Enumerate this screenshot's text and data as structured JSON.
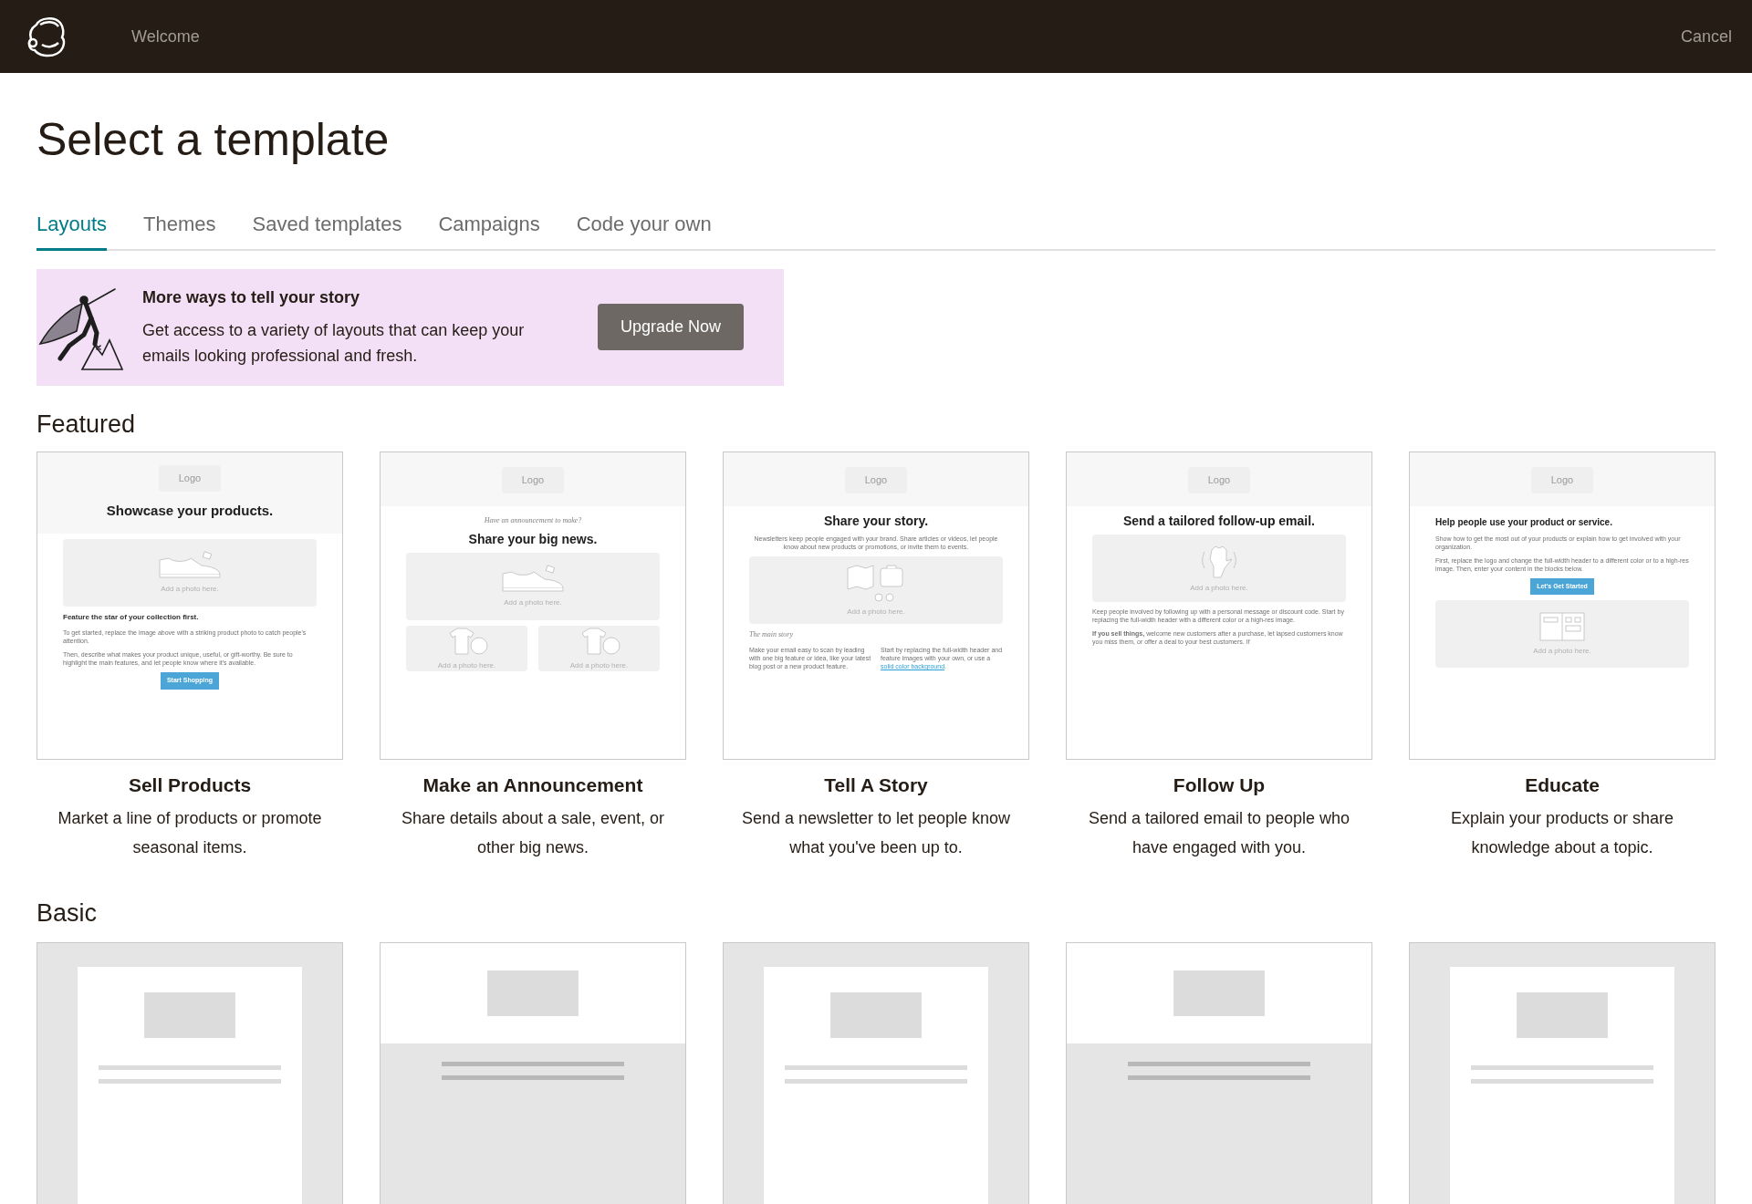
{
  "top_bar": {
    "welcome": "Welcome",
    "cancel": "Cancel"
  },
  "title": "Select a template",
  "tabs": [
    {
      "label": "Layouts",
      "selected": true
    },
    {
      "label": "Themes",
      "selected": false
    },
    {
      "label": "Saved templates",
      "selected": false
    },
    {
      "label": "Campaigns",
      "selected": false
    },
    {
      "label": "Code your own",
      "selected": false
    }
  ],
  "banner": {
    "heading": "More ways to tell your story",
    "text": "Get access to a variety of layouts that can keep your emails looking professional and fresh.",
    "button": "Upgrade Now"
  },
  "featured": {
    "heading": "Featured",
    "templates": [
      {
        "name": "Sell Products",
        "description": "Market a line of products or promote seasonal items.",
        "blocks": [
          {
            "kind": "header",
            "logo": "Logo",
            "heading": "Showcase your products."
          },
          {
            "kind": "photo",
            "caption": "Add a photo here."
          },
          {
            "kind": "subheading",
            "text": "Feature the star of your collection first."
          },
          {
            "kind": "text",
            "text": "To get started, replace the image above with a striking product photo to catch people's attention."
          },
          {
            "kind": "text",
            "text": "Then, describe what makes your product unique, useful, or gift-worthy. Be sure to highlight the main features, and let people know where it's available."
          },
          {
            "kind": "button",
            "label": "Start Shopping"
          }
        ]
      },
      {
        "name": "Make an Announcement",
        "description": "Share details about a sale, event, or other big news.",
        "blocks": [
          {
            "kind": "header",
            "logo": "Logo"
          },
          {
            "kind": "eyebrow",
            "text": "Have an announcement to make?"
          },
          {
            "kind": "title",
            "text": "Share your big news."
          },
          {
            "kind": "photo",
            "caption": "Add a photo here."
          },
          {
            "kind": "photo_pair",
            "captions": [
              "Add a photo here.",
              "Add a photo here."
            ]
          }
        ]
      },
      {
        "name": "Tell A Story",
        "description": "Send a newsletter to let people know what you've been up to.",
        "blocks": [
          {
            "kind": "header",
            "logo": "Logo"
          },
          {
            "kind": "title",
            "text": "Share your story."
          },
          {
            "kind": "intro",
            "text": "Newsletters keep people engaged with your brand. Share articles or videos, let people know about new products or promotions, or invite them to events."
          },
          {
            "kind": "photo",
            "caption": "Add a photo here."
          },
          {
            "kind": "section_label",
            "text": "The main story"
          },
          {
            "kind": "columns",
            "columns": [
              {
                "text": "Make your email easy to scan by leading with one big feature or idea, like your latest blog post or a new product feature."
              },
              {
                "text": "Start by replacing the full-width header and feature images with your own, or use a",
                "link": "solid color background",
                "after": "."
              }
            ]
          }
        ]
      },
      {
        "name": "Follow Up",
        "description": "Send a tailored email to people who have engaged with you.",
        "blocks": [
          {
            "kind": "header",
            "logo": "Logo"
          },
          {
            "kind": "title",
            "text": "Send a tailored follow-up email."
          },
          {
            "kind": "photo",
            "caption": "Add a photo here."
          },
          {
            "kind": "text",
            "text": "Keep people involved by following up with a personal message or discount code. Start by replacing the full-width header with a different color or a high-res image."
          },
          {
            "kind": "text",
            "text": "**If you sell things,** welcome new customers after a purchase, let lapsed customers know you miss them, or offer a deal to your best customers. If"
          }
        ]
      },
      {
        "name": "Educate",
        "description": "Explain your products or share knowledge about a topic.",
        "blocks": [
          {
            "kind": "header",
            "logo": "Logo"
          },
          {
            "kind": "left_title",
            "text": "Help people use your product or service."
          },
          {
            "kind": "text",
            "text": "Show how to get the most out of your products or explain how to get involved with your organization."
          },
          {
            "kind": "text",
            "text": "First, replace the logo and change the full-width header to a different color or to a high-res image. Then, enter your content in the blocks below."
          },
          {
            "kind": "button",
            "label": "Let's Get Started"
          },
          {
            "kind": "photo",
            "caption": "Add a photo here."
          }
        ]
      }
    ]
  },
  "basic": {
    "heading": "Basic",
    "templates": [
      {
        "kind": "boxed"
      },
      {
        "kind": "banded"
      },
      {
        "kind": "boxed"
      },
      {
        "kind": "banded"
      },
      {
        "kind": "boxed"
      }
    ]
  }
}
